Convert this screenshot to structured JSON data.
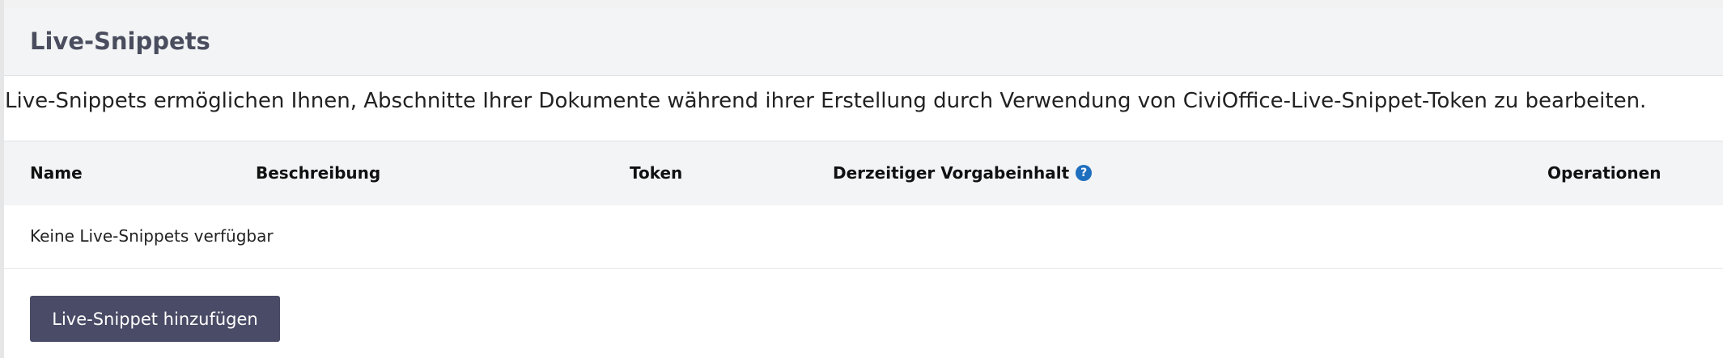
{
  "panel": {
    "title": "Live-Snippets"
  },
  "description": "Live-Snippets ermöglichen Ihnen, Abschnitte Ihrer Dokumente während ihrer Erstellung durch Verwendung von CiviOffice-Live-Snippet-Token zu bearbeiten.",
  "table": {
    "columns": {
      "name": "Name",
      "description": "Beschreibung",
      "token": "Token",
      "default_content": "Derzeitiger Vorgabeinhalt",
      "operations": "Operationen"
    },
    "help_icon_glyph": "?",
    "empty_message": "Keine Live-Snippets verfügbar"
  },
  "actions": {
    "add_label": "Live-Snippet hinzufügen"
  },
  "colors": {
    "header_bg": "#f2f4f5",
    "title_text": "#4a4d5e",
    "button_bg": "#4a4b66",
    "help_icon_bg": "#1f6fbf"
  },
  "icons": {
    "help": "help-icon"
  }
}
